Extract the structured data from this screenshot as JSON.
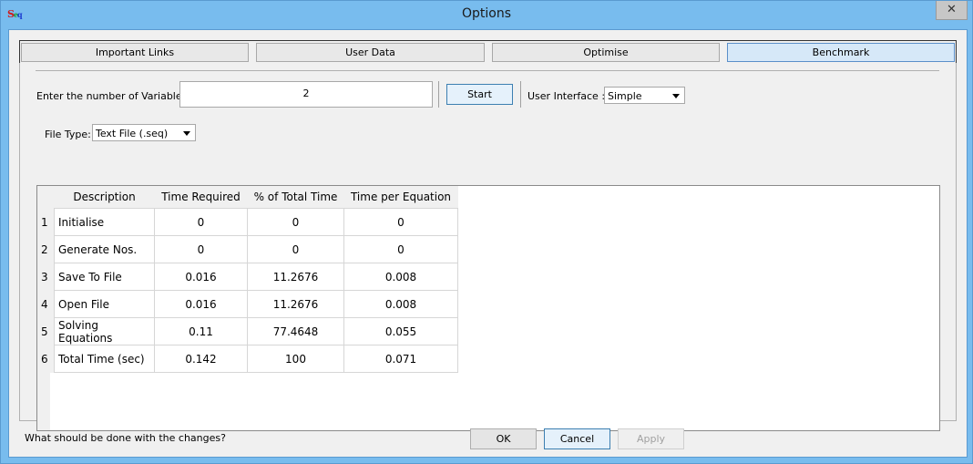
{
  "window": {
    "title": "Options",
    "icon_letters": [
      "S",
      "e",
      "q"
    ],
    "close_glyph": "✕"
  },
  "tabs": [
    {
      "label": "Important Links",
      "active": false
    },
    {
      "label": "User Data",
      "active": false
    },
    {
      "label": "Optimise",
      "active": false
    },
    {
      "label": "Benchmark",
      "active": true
    }
  ],
  "controls": {
    "variables_label": "Enter the number of Variables :",
    "variables_value": "2",
    "start_label": "Start",
    "ui_label": "User Interface :",
    "ui_value": "Simple",
    "filetype_label": "File Type:",
    "filetype_value": "Text File (.seq)"
  },
  "table": {
    "headers": [
      "Description",
      "Time Required",
      "% of Total Time",
      "Time per Equation"
    ],
    "rows": [
      {
        "n": "1",
        "desc": "Initialise",
        "time": "0",
        "pct": "0",
        "per_eq": "0"
      },
      {
        "n": "2",
        "desc": "Generate Nos.",
        "time": "0",
        "pct": "0",
        "per_eq": "0"
      },
      {
        "n": "3",
        "desc": "Save To File",
        "time": "0.016",
        "pct": "11.2676",
        "per_eq": "0.008"
      },
      {
        "n": "4",
        "desc": "Open File",
        "time": "0.016",
        "pct": "11.2676",
        "per_eq": "0.008"
      },
      {
        "n": "5",
        "desc": "Solving Equations",
        "time": "0.11",
        "pct": "77.4648",
        "per_eq": "0.055"
      },
      {
        "n": "6",
        "desc": "Total Time (sec)",
        "time": "0.142",
        "pct": "100",
        "per_eq": "0.071"
      }
    ]
  },
  "footer": {
    "question": "What should be done with the changes?",
    "ok": "OK",
    "cancel": "Cancel",
    "apply": "Apply"
  }
}
